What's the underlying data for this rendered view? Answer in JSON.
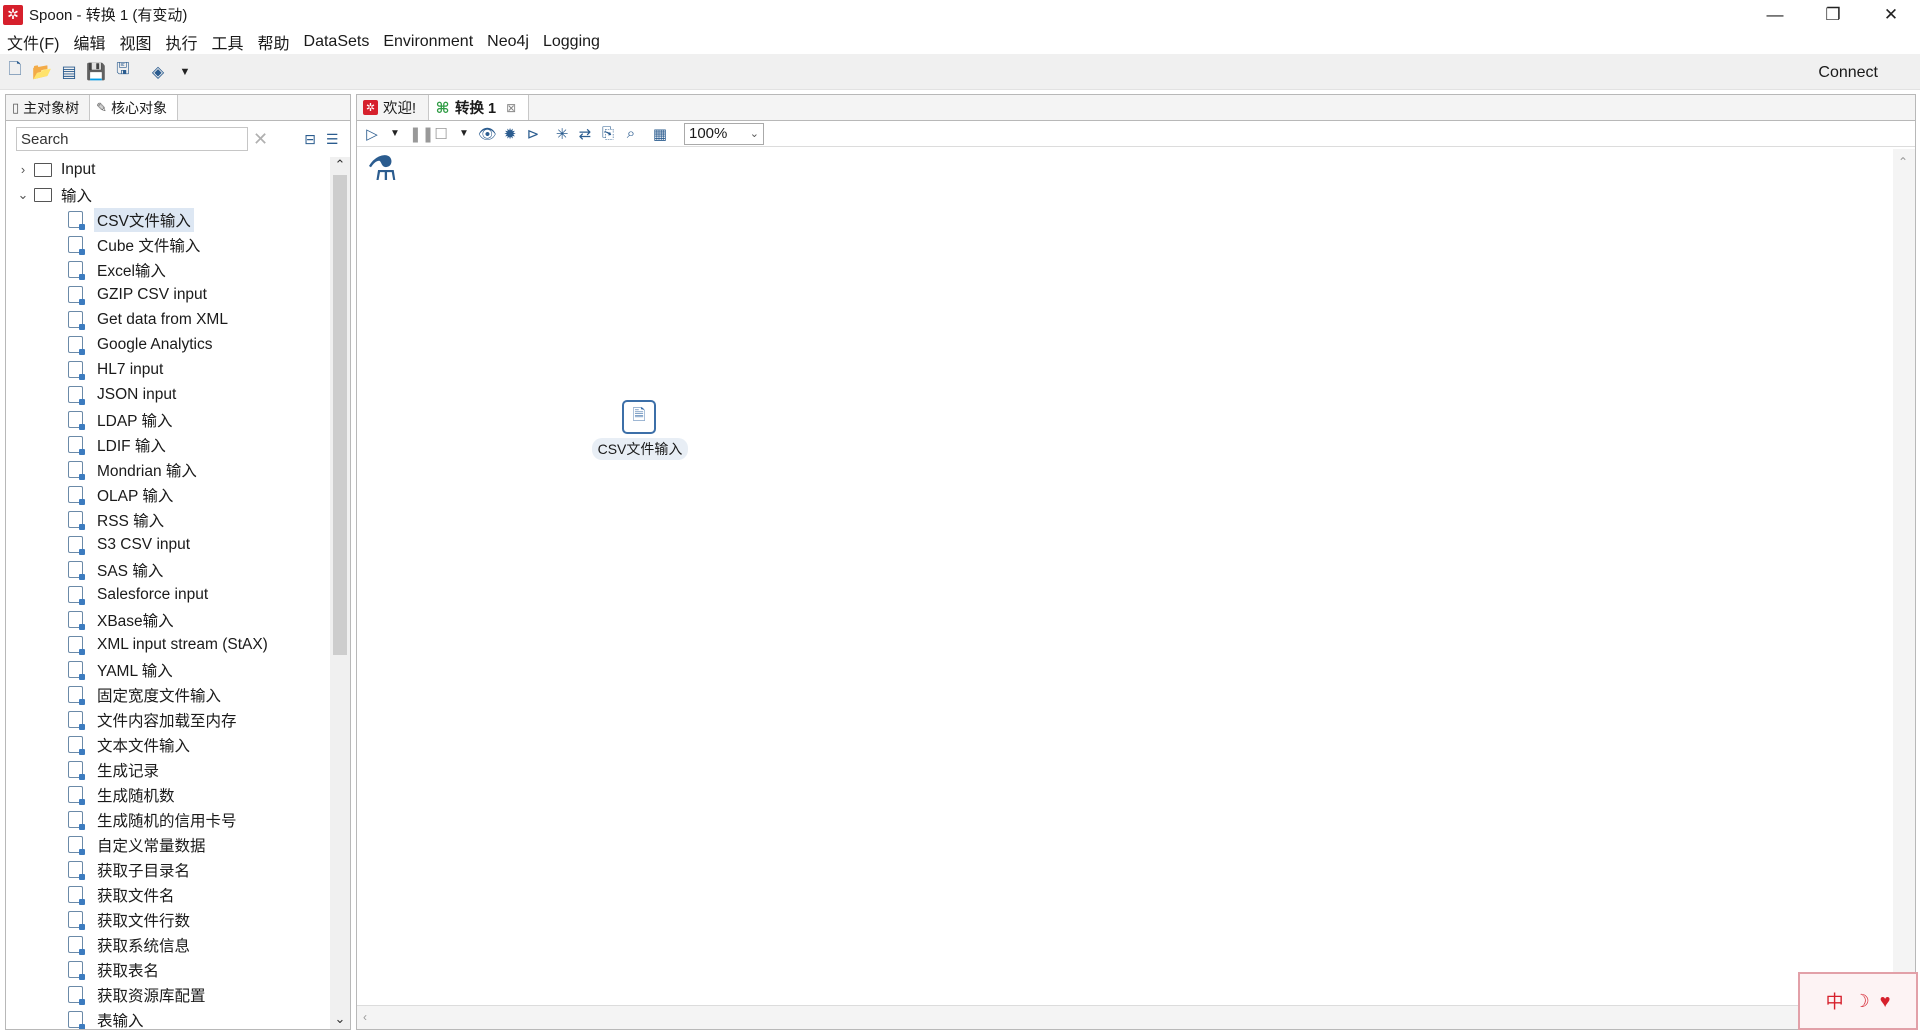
{
  "window": {
    "title": "Spoon - 转换 1 (有变动)",
    "app_icon": "✲",
    "controls": [
      "—",
      "❐",
      "✕"
    ]
  },
  "menu": [
    "文件(F)",
    "编辑",
    "视图",
    "执行",
    "工具",
    "帮助",
    "DataSets",
    "Environment",
    "Neo4j",
    "Logging"
  ],
  "toolbar": {
    "connect_label": "Connect"
  },
  "left_panel": {
    "tabs": [
      "主对象树",
      "核心对象"
    ],
    "search": {
      "placeholder": "Search",
      "value": "Search"
    },
    "folders": [
      {
        "label": "Input",
        "expanded": false
      },
      {
        "label": "输入",
        "expanded": true
      }
    ],
    "items": [
      "CSV文件输入",
      "Cube 文件输入",
      "Excel输入",
      "GZIP CSV input",
      "Get data from XML",
      "Google Analytics",
      "HL7 input",
      "JSON input",
      "LDAP 输入",
      "LDIF 输入",
      "Mondrian 输入",
      "OLAP 输入",
      "RSS 输入",
      "S3 CSV input",
      "SAS 输入",
      "Salesforce input",
      "XBase输入",
      "XML input stream (StAX)",
      "YAML 输入",
      "固定宽度文件输入",
      "文件内容加载至内存",
      "文本文件输入",
      "生成记录",
      "生成随机数",
      "生成随机的信用卡号",
      "自定义常量数据",
      "获取子目录名",
      "获取文件名",
      "获取文件行数",
      "获取系统信息",
      "获取表名",
      "获取资源库配置",
      "表输入"
    ],
    "selected_index": 0
  },
  "right_panel": {
    "tabs": [
      {
        "label": "欢迎!",
        "icon": "spoon-icon",
        "active": false
      },
      {
        "label": "转换 1",
        "icon": "transformation-icon",
        "active": true
      }
    ],
    "zoom": "100%",
    "step_label": "CSV文件输入"
  },
  "colors": {
    "accent": "#2b5c8f",
    "brand": "#d6202c",
    "selection": "#dde7f3"
  }
}
